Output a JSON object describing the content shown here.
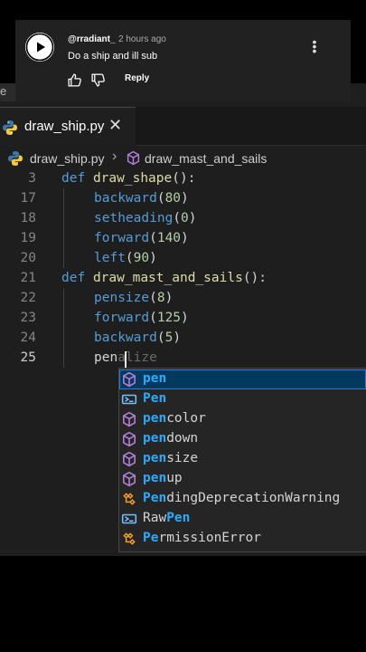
{
  "notification": {
    "author": "@rradiant_",
    "age": "2 hours ago",
    "comment": "Do a ship and ill sub",
    "reply_label": "Reply",
    "icons": [
      "play-icon",
      "more-vertical-icon",
      "thumbs-up-icon",
      "thumbs-down-icon"
    ]
  },
  "editor": {
    "left_strip_text": "e",
    "tab": {
      "label": "draw_ship.py",
      "close": "✕",
      "icon": "python-icon"
    },
    "breadcrumb": {
      "file": "draw_ship.py",
      "separator": "›",
      "symbol": "draw_mast_and_sails",
      "symbol_icon": "method-cube-icon"
    },
    "lines": [
      {
        "n": "3",
        "text": "def draw_shape():"
      },
      {
        "n": "17",
        "text": "    backward(80)"
      },
      {
        "n": "18",
        "text": "    setheading(0)"
      },
      {
        "n": "19",
        "text": "    forward(140)"
      },
      {
        "n": "20",
        "text": "    left(90)"
      },
      {
        "n": "21",
        "text": "def draw_mast_and_sails():"
      },
      {
        "n": "22",
        "text": "    pensize(8)"
      },
      {
        "n": "23",
        "text": "    forward(125)"
      },
      {
        "n": "24",
        "text": "    backward(5)"
      },
      {
        "n": "25",
        "text": "    pen",
        "ghost": "alize"
      }
    ],
    "colors": {
      "keyword": "#569cd6",
      "function": "#dcdcaa",
      "number": "#b5cea8",
      "match": "#2aaaff",
      "selection": "#04395e"
    }
  },
  "suggestions": [
    {
      "label": "pen",
      "match": "pen",
      "rest": "",
      "icon": "method-cube-icon",
      "selected": true
    },
    {
      "label": "Pen",
      "match": "Pen",
      "rest": "",
      "icon": "variable-icon"
    },
    {
      "label": "pencolor",
      "match": "pen",
      "rest": "color",
      "icon": "method-cube-icon"
    },
    {
      "label": "pendown",
      "match": "pen",
      "rest": "down",
      "icon": "method-cube-icon"
    },
    {
      "label": "pensize",
      "match": "pen",
      "rest": "size",
      "icon": "method-cube-icon"
    },
    {
      "label": "penup",
      "match": "pen",
      "rest": "up",
      "icon": "method-cube-icon"
    },
    {
      "label": "PendingDeprecationWarning",
      "match": "Pen",
      "rest": "dingDeprecationWarning",
      "icon": "class-icon"
    },
    {
      "label": "RawPen",
      "pre": "Raw",
      "match": "Pen",
      "rest": "",
      "icon": "variable-icon"
    },
    {
      "label": "PermissionError",
      "match": "Pe",
      "rest": "rmissionError",
      "icon": "class-icon"
    }
  ]
}
